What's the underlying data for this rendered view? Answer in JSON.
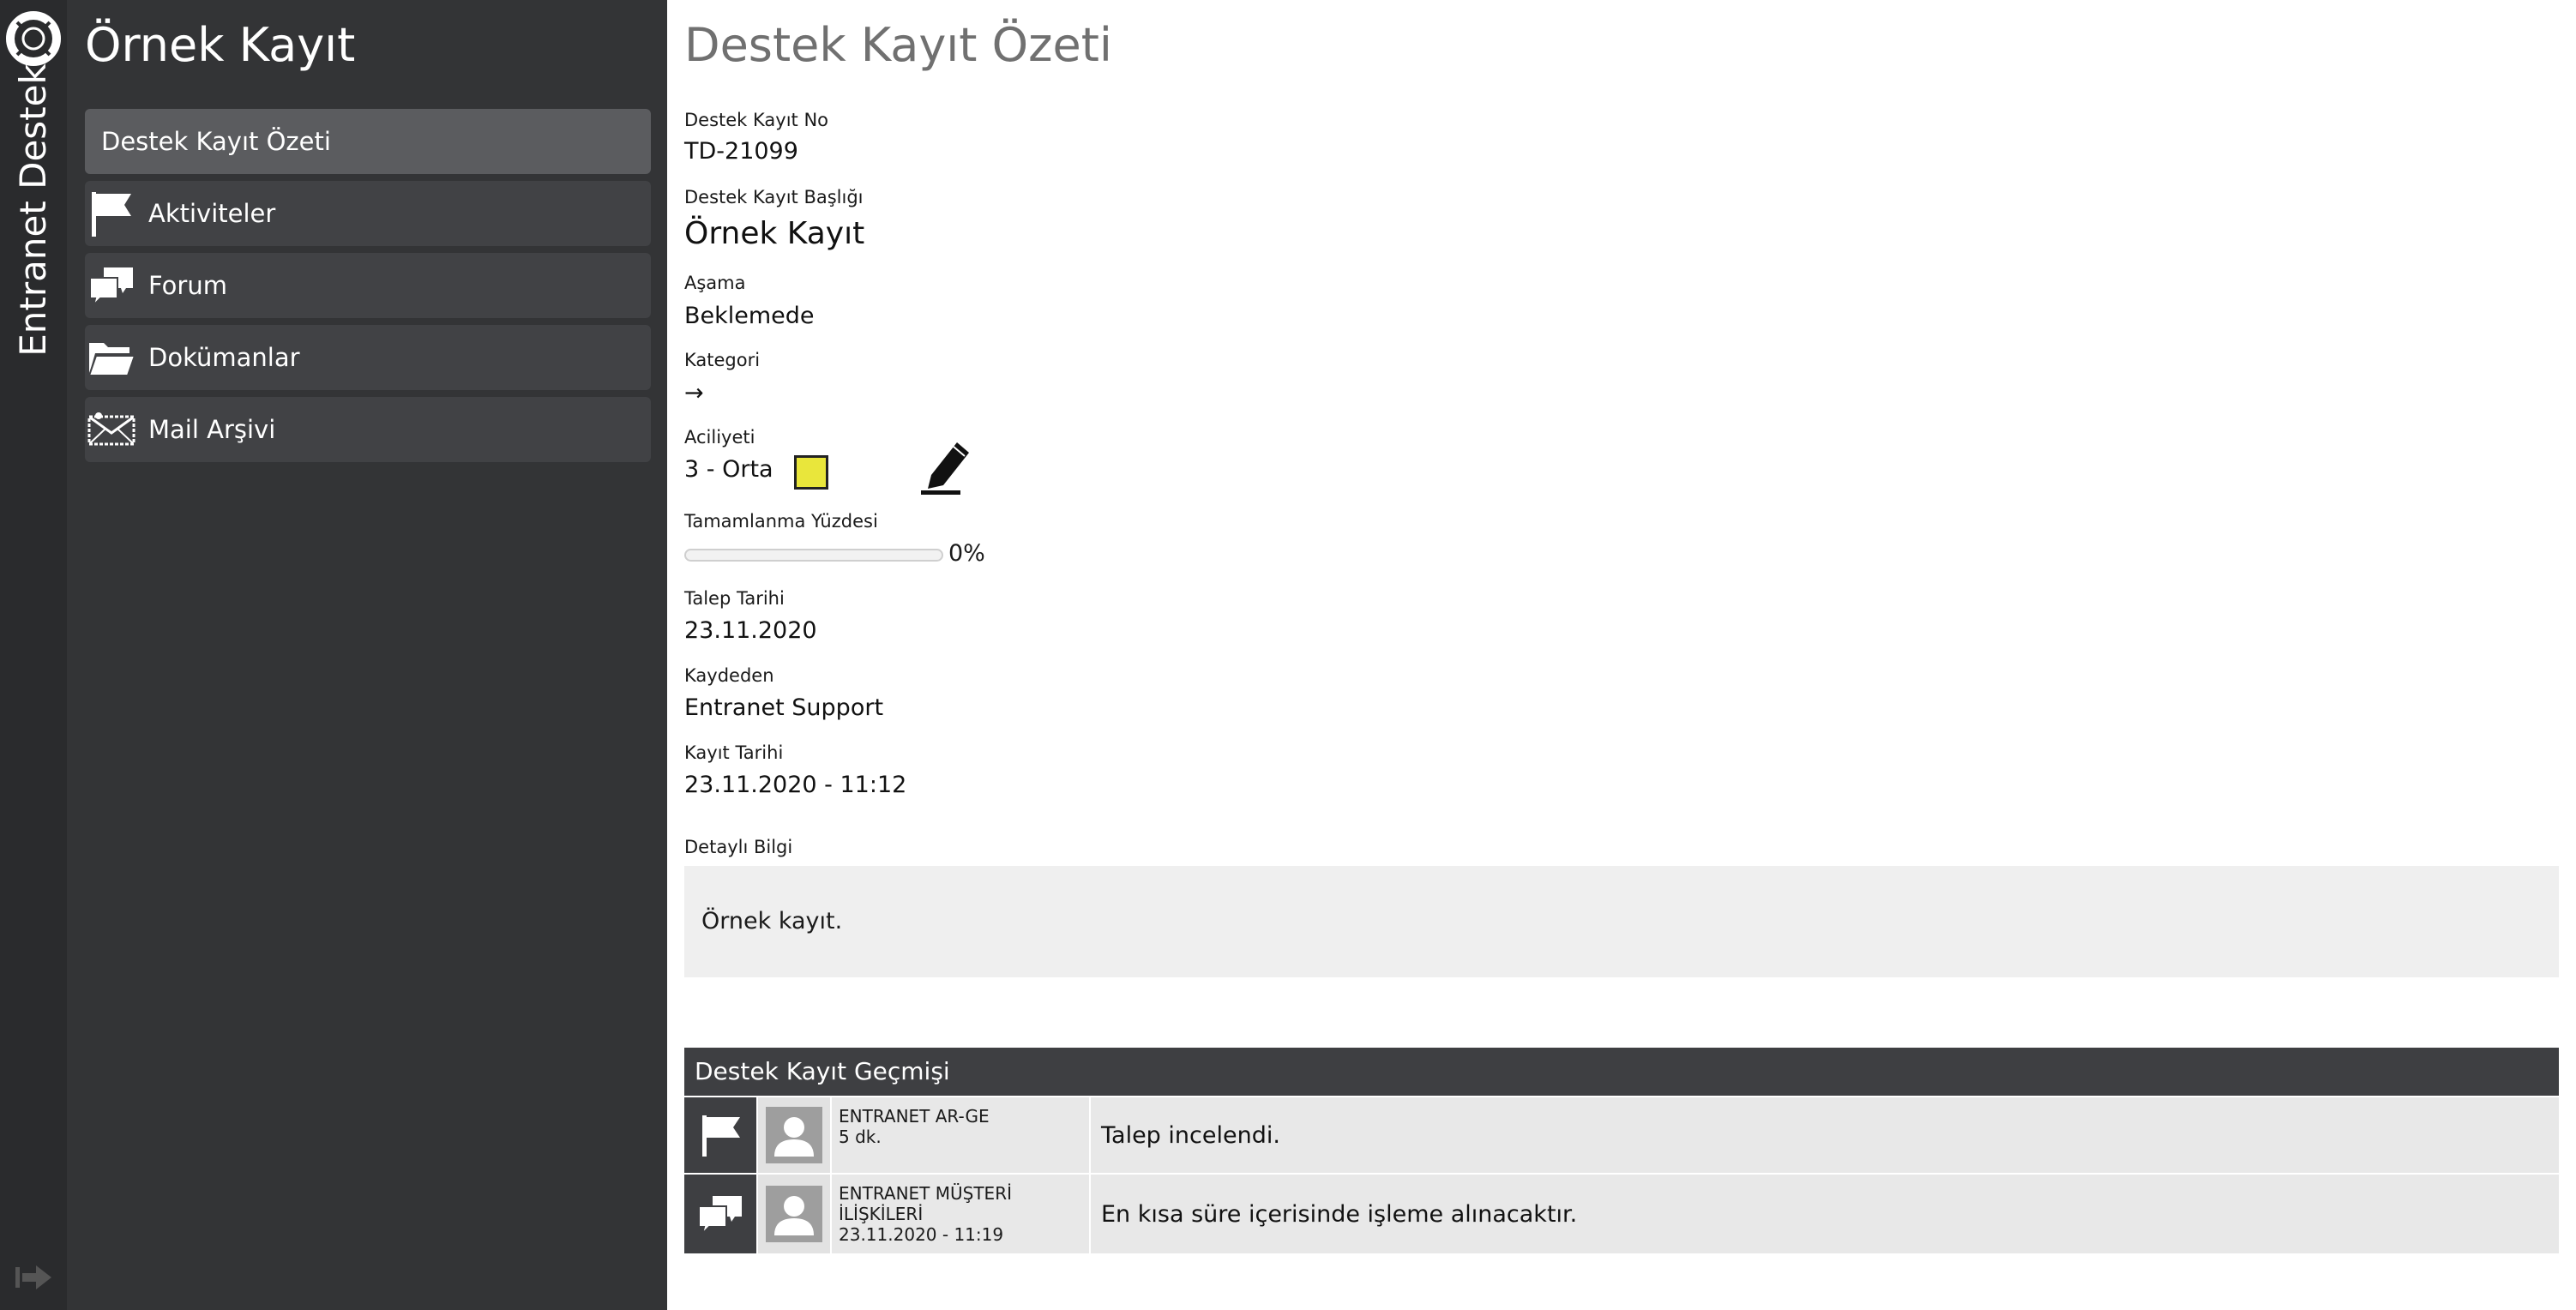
{
  "app": {
    "name": "Entranet Destek",
    "icons": {
      "logo": "lifebuoy-icon",
      "exit": "sign-out-icon"
    }
  },
  "sidebar": {
    "title": "Örnek Kayıt",
    "items": [
      {
        "label": "Destek Kayıt Özeti",
        "active": true,
        "icon": ""
      },
      {
        "label": "Aktiviteler",
        "active": false,
        "icon": "flag-icon"
      },
      {
        "label": "Forum",
        "active": false,
        "icon": "chat-bubbles-icon"
      },
      {
        "label": "Dokümanlar",
        "active": false,
        "icon": "folder-icon"
      },
      {
        "label": "Mail Arşivi",
        "active": false,
        "icon": "envelope-icon"
      }
    ]
  },
  "summary": {
    "page_title": "Destek Kayıt Özeti",
    "fields": {
      "ticket_no": {
        "label": "Destek Kayıt No",
        "value": "TD-21099"
      },
      "ticket_title": {
        "label": "Destek Kayıt Başlığı",
        "value": "Örnek Kayıt"
      },
      "stage": {
        "label": "Aşama",
        "value": "Beklemede"
      },
      "category": {
        "label": "Kategori",
        "value": "→"
      },
      "urgency": {
        "label": "Aciliyeti",
        "value": "3 - Orta",
        "color": "#e9e63b"
      },
      "completion": {
        "label": "Tamamlanma Yüzdesi",
        "text": "0%",
        "percent": 0
      },
      "request_date": {
        "label": "Talep Tarihi",
        "value": "23.11.2020"
      },
      "created_by": {
        "label": "Kaydeden",
        "value": "Entranet Support"
      },
      "record_date": {
        "label": "Kayıt Tarihi",
        "value": "23.11.2020 - 11:12"
      }
    },
    "detail": {
      "label": "Detaylı Bilgi",
      "text": "Örnek kayıt."
    }
  },
  "history": {
    "title": "Destek Kayıt Geçmişi",
    "rows": [
      {
        "type_icon": "flag-icon",
        "who": "ENTRANET AR-GE",
        "when": "5 dk.",
        "message": "Talep incelendi."
      },
      {
        "type_icon": "chat-bubbles-icon",
        "who": "ENTRANET MÜŞTERİ İLİŞKİLERİ",
        "when": "23.11.2020 - 11:19",
        "message": "En kısa süre içerisinde işleme alınacaktır."
      }
    ]
  },
  "colors": {
    "rail": "#2a2b2d",
    "panel": "#333436",
    "nav_item": "#414245",
    "nav_active": "#5b5c5f",
    "urgency_medium": "#e9e63b",
    "table_header": "#3e3f42"
  }
}
